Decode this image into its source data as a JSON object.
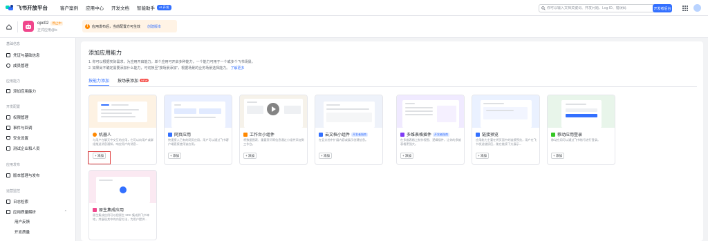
{
  "topnav": {
    "brand": "飞书开放平台",
    "links": [
      "客户案例",
      "应用中心",
      "开发文档",
      "智能助手"
    ],
    "ai_badge": "AI 开发",
    "search_placeholder": "你可以输入文档关键词、开发问题、Log ID、错误码",
    "dev_button": "开发者后台"
  },
  "app": {
    "name": "opc02",
    "badge": "停止中",
    "sub": "正式应用@ls",
    "notice": "应用发布后，当前配置方可生效",
    "notice_link": "创建版本"
  },
  "sidebar": {
    "groups": [
      {
        "label": "基础信息",
        "items": [
          {
            "label": "凭证与基础信息",
            "icon": "credential-icon"
          },
          {
            "label": "成员管理",
            "icon": "member-icon"
          }
        ]
      },
      {
        "label": "应用能力",
        "items": [
          {
            "label": "添加应用能力",
            "icon": "add-capability-icon"
          }
        ]
      },
      {
        "label": "开发配置",
        "items": [
          {
            "label": "权限管理",
            "icon": "permission-icon"
          },
          {
            "label": "事件与回调",
            "icon": "event-icon"
          },
          {
            "label": "安全设置",
            "icon": "security-icon"
          },
          {
            "label": "测试企业和人员",
            "icon": "test-icon"
          }
        ]
      },
      {
        "label": "应用发布",
        "items": [
          {
            "label": "版本管理与发布",
            "icon": "version-icon"
          }
        ]
      },
      {
        "label": "运营监控",
        "items": [
          {
            "label": "日志检索",
            "icon": "log-icon"
          },
          {
            "label": "应用质量解析",
            "icon": "quality-icon"
          }
        ]
      }
    ],
    "subitems": [
      "用户反馈",
      "开发质量"
    ]
  },
  "main": {
    "title": "添加应用能力",
    "desc1": "1. 你可以根据实际需求，为应用开启能力。单个应用可开启多种能力，一个能力可用于一个或多个飞书场景。",
    "desc2": "2. 如果尚不确定需要添加什么能力，可切换至\"按场景添加\"，根据场景的业务场景选择能力。",
    "desc2_link": "了解更多",
    "tabs": [
      "按能力添加",
      "按场景添加"
    ],
    "new_badge": "NEW",
    "add_label": "+ 添加",
    "cards": [
      {
        "title": "机器人",
        "tag": "",
        "desc": "与用户在聊天中交互的应用，它可以向用户或群组推送消息通知，响应用户的消息...",
        "icon_color": "#ff8800",
        "thumb": "#fdf2e3"
      },
      {
        "title": "网页应用",
        "tag": "",
        "desc": "快速接入已有的网页应用，用户可以通过飞书客户端直接使用该应用。",
        "icon_color": "#3370ff",
        "thumb": "#e9efff"
      },
      {
        "title": "工作台小组件",
        "tag": "",
        "desc": "将数据图表、重要资讯等信息通过小组件添加到工作台。",
        "icon_color": "#ff8800",
        "thumb": "#f6f2ea"
      },
      {
        "title": "云文档小组件",
        "tag": "开发者指南",
        "desc": "在云文档中扩展内容或展示创建信息。",
        "icon_color": "#3370ff",
        "thumb": "#eef2fa"
      },
      {
        "title": "多维表格插件",
        "tag": "开发者指南",
        "desc": "在多维表格上制作视图、逻辑插件，让你的多维表格更强大。",
        "icon_color": "#7f3bf5",
        "thumb": "#f0eaff"
      },
      {
        "title": "链接预览",
        "tag": "",
        "desc": "应用能力主要在将页面中的链接预览，用户在飞书发送链接后，能在链接下方展示...",
        "icon_color": "#3370ff",
        "thumb": "#eaf1ff"
      },
      {
        "title": "移动应用登录",
        "tag": "",
        "desc": "移动应用可以通过飞书账号进行登录。",
        "icon_color": "#34c724",
        "thumb": "#e8f5ea"
      },
      {
        "title": "原生集成应用",
        "tag": "",
        "desc": "原生集成应用可以把原生 SDK 集成到飞书本地，并展现其中的内容方法，为用户提供...",
        "icon_color": "#f0468c",
        "thumb": "#fbe9f2"
      }
    ]
  }
}
